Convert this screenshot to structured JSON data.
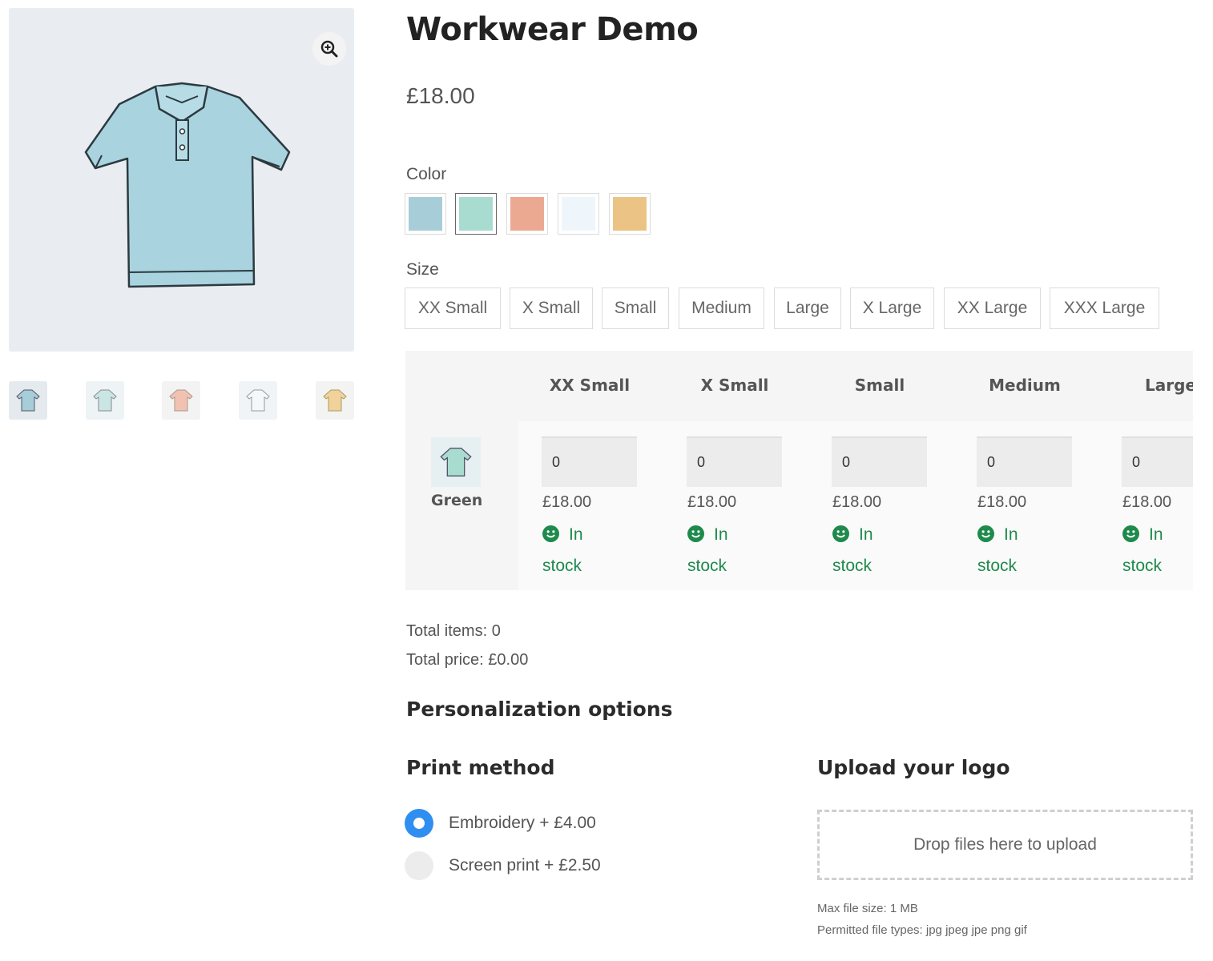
{
  "product": {
    "title": "Workwear Demo",
    "price": "£18.00"
  },
  "gallery": {
    "zoom_icon": "zoom-in-icon",
    "thumbnails": [
      {
        "color": "#a6cdd8"
      },
      {
        "color": "#c9e6e2"
      },
      {
        "color": "#f1c2b2"
      },
      {
        "color": "#f4f8fb"
      },
      {
        "color": "#f0d29a"
      }
    ]
  },
  "color_selector": {
    "label": "Color",
    "swatches": [
      {
        "color": "#a6cdd8",
        "selected": false
      },
      {
        "color": "#a9dcd0",
        "selected": true
      },
      {
        "color": "#eca992",
        "selected": false
      },
      {
        "color": "#eef6fb",
        "selected": false
      },
      {
        "color": "#ebc485",
        "selected": false
      }
    ]
  },
  "size_selector": {
    "label": "Size",
    "options": [
      "XX Small",
      "X Small",
      "Small",
      "Medium",
      "Large",
      "X Large",
      "XX Large",
      "XXX Large"
    ]
  },
  "bulk_table": {
    "columns": [
      "XX Small",
      "X Small",
      "Small",
      "Medium",
      "Large"
    ],
    "row": {
      "label": "Green",
      "cells": [
        {
          "qty": "0",
          "price": "£18.00",
          "stock_1": "In",
          "stock_2": "stock"
        },
        {
          "qty": "0",
          "price": "£18.00",
          "stock_1": "In",
          "stock_2": "stock"
        },
        {
          "qty": "0",
          "price": "£18.00",
          "stock_1": "In",
          "stock_2": "stock"
        },
        {
          "qty": "0",
          "price": "£18.00",
          "stock_1": "In",
          "stock_2": "stock"
        },
        {
          "qty": "0",
          "price": "£18.00",
          "stock_1": "In",
          "stock_2": "stock"
        }
      ]
    },
    "stock_color": "#1e8a4c"
  },
  "totals": {
    "items": "Total items: 0",
    "price": "Total price: £0.00"
  },
  "personalization": {
    "heading": "Personalization options",
    "print_method": {
      "heading": "Print method",
      "options": [
        {
          "label": "Embroidery + £4.00",
          "selected": true
        },
        {
          "label": "Screen print + £2.50",
          "selected": false
        }
      ]
    },
    "upload": {
      "heading": "Upload your logo",
      "dropzone": "Drop files here to upload",
      "max_size": "Max file size: 1 MB",
      "file_types": "Permitted file types: jpg jpeg jpe png gif"
    }
  },
  "accent_color": "#2f8ff0"
}
